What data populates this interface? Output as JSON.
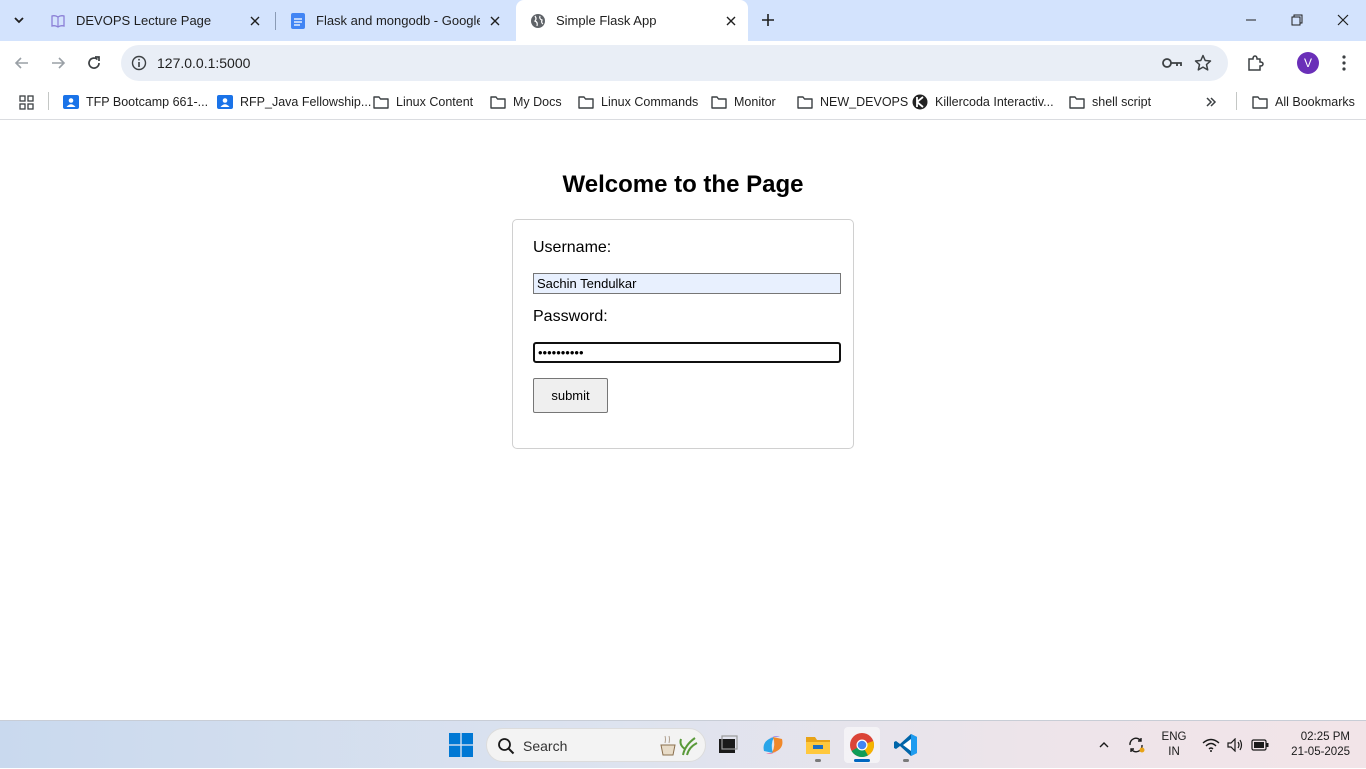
{
  "browser": {
    "tabs": [
      {
        "title": "DEVOPS Lecture Page",
        "active": false,
        "icon": "book-icon"
      },
      {
        "title": "Flask and mongodb - Google D",
        "active": false,
        "icon": "docs-icon"
      },
      {
        "title": "Simple Flask App",
        "active": true,
        "icon": "globe-icon"
      }
    ],
    "url": "127.0.0.1:5000",
    "profile_initial": "V",
    "accent_color": "#d3e3fd"
  },
  "bookmarks": {
    "items": [
      {
        "label": "TFP Bootcamp 661-...",
        "icon": "classroom-icon"
      },
      {
        "label": "RFP_Java Fellowship...",
        "icon": "classroom-icon"
      },
      {
        "label": "Linux Content",
        "icon": "folder-icon"
      },
      {
        "label": "My Docs",
        "icon": "folder-icon"
      },
      {
        "label": "Linux Commands",
        "icon": "folder-icon"
      },
      {
        "label": "Monitor",
        "icon": "folder-icon"
      },
      {
        "label": "NEW_DEVOPS",
        "icon": "folder-icon"
      },
      {
        "label": "Killercoda Interactiv...",
        "icon": "killercoda-icon"
      },
      {
        "label": "shell script",
        "icon": "folder-icon"
      }
    ],
    "all_bookmarks": "All Bookmarks"
  },
  "page": {
    "heading": "Welcome to the Page",
    "username_label": "Username:",
    "username_value": "Sachin Tendulkar",
    "password_label": "Password:",
    "password_value": "••••••••••",
    "submit_label": "submit"
  },
  "taskbar": {
    "search_placeholder": "Search",
    "language_top": "ENG",
    "language_bottom": "IN",
    "time": "02:25 PM",
    "date": "21-05-2025"
  }
}
